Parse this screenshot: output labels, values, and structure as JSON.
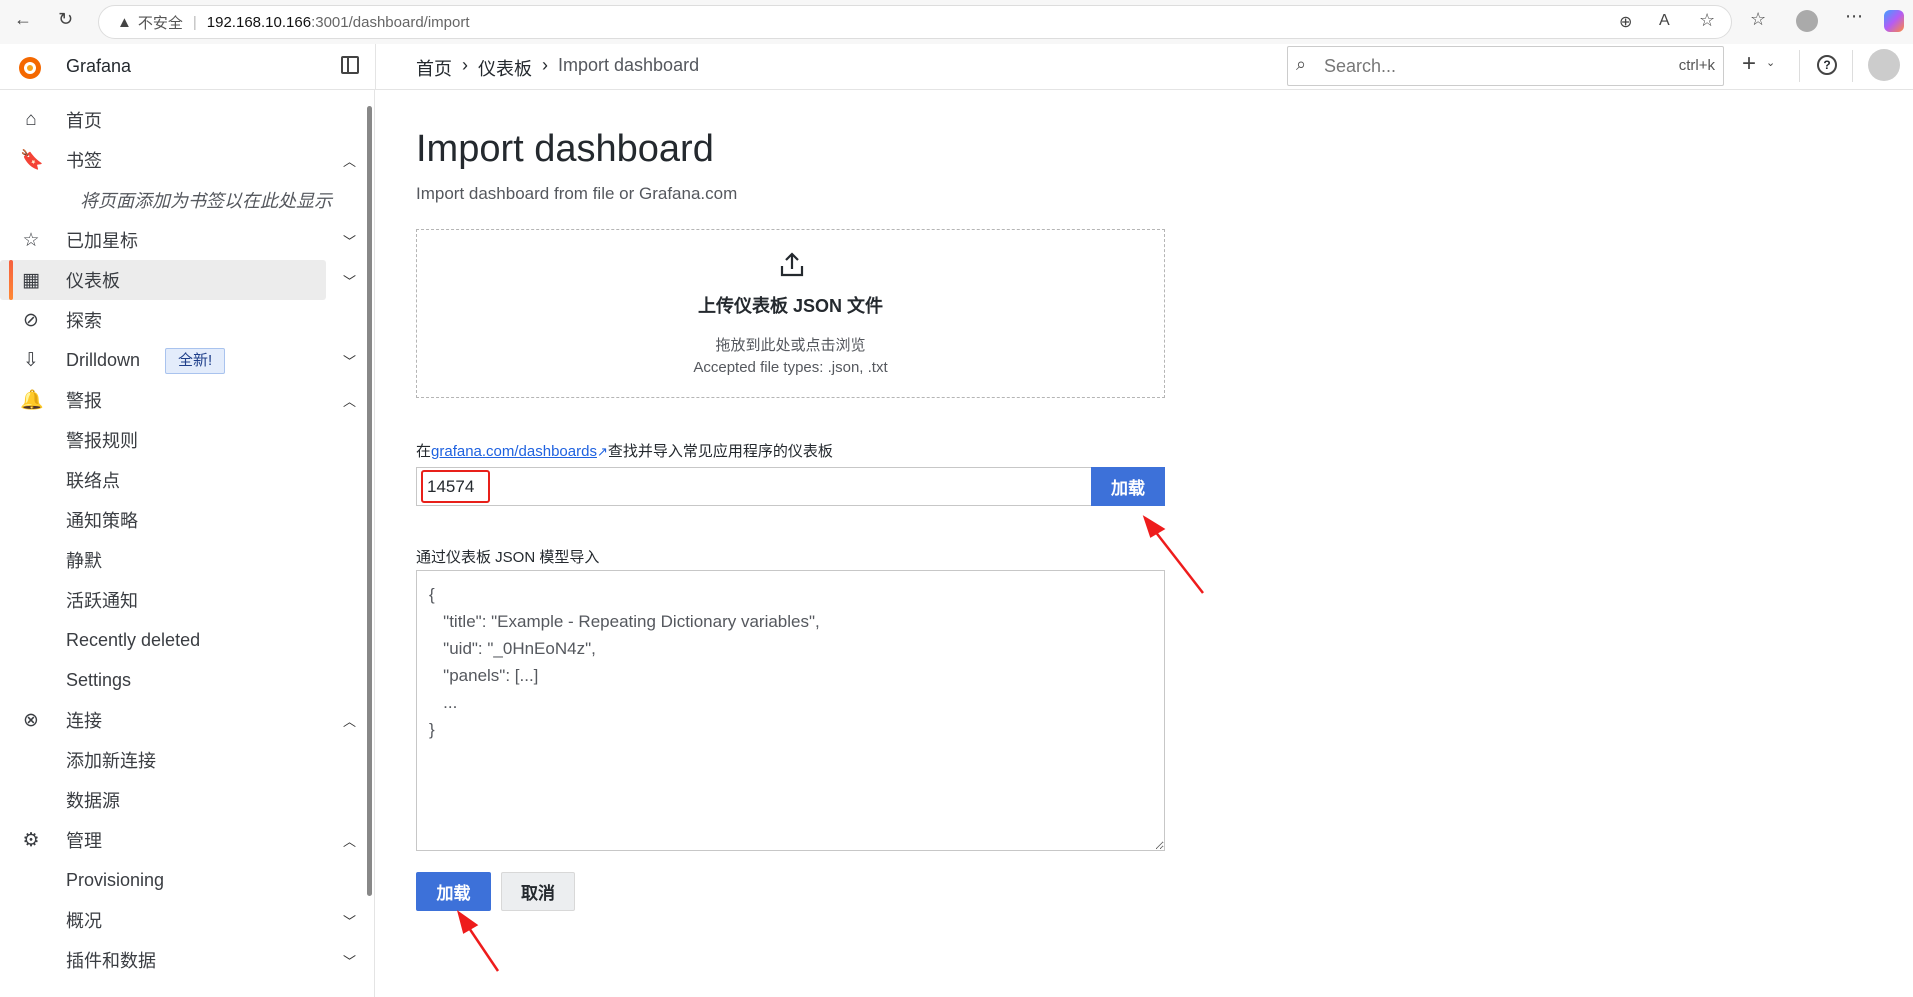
{
  "browser": {
    "security_label": "不安全",
    "url_host": "192.168.10.166",
    "url_path": ":3001/dashboard/import"
  },
  "header": {
    "app_name": "Grafana",
    "breadcrumb": [
      "首页",
      "仪表板",
      "Import dashboard"
    ],
    "search_placeholder": "Search...",
    "search_shortcut": "ctrl+k"
  },
  "sidebar": {
    "items": [
      {
        "label": "首页",
        "icon": "home-icon"
      },
      {
        "label": "书签",
        "icon": "bookmark-icon",
        "chevron": "up"
      },
      {
        "label": "将页面添加为书签以在此处显示",
        "hint": true
      },
      {
        "label": "已加星标",
        "icon": "star-icon",
        "chevron": "down"
      },
      {
        "label": "仪表板",
        "icon": "apps-icon",
        "chevron": "down",
        "active": true
      },
      {
        "label": "探索",
        "icon": "compass-icon"
      },
      {
        "label": "Drilldown",
        "icon": "drilldown-icon",
        "chevron": "down",
        "badge": "全新!"
      },
      {
        "label": "警报",
        "icon": "bell-icon",
        "chevron": "up"
      },
      {
        "label": "警报规则"
      },
      {
        "label": "联络点"
      },
      {
        "label": "通知策略"
      },
      {
        "label": "静默"
      },
      {
        "label": "活跃通知"
      },
      {
        "label": "Recently deleted"
      },
      {
        "label": "Settings"
      },
      {
        "label": "连接",
        "icon": "link-icon",
        "chevron": "up"
      },
      {
        "label": "添加新连接"
      },
      {
        "label": "数据源"
      },
      {
        "label": "管理",
        "icon": "gear-icon",
        "chevron": "up"
      },
      {
        "label": "Provisioning"
      },
      {
        "label": "概况",
        "chevron": "down"
      },
      {
        "label": "插件和数据",
        "chevron": "down"
      }
    ]
  },
  "main": {
    "title": "Import dashboard",
    "subtitle": "Import dashboard from file or Grafana.com",
    "upload": {
      "title": "上传仪表板 JSON 文件",
      "hint": "拖放到此处或点击浏览",
      "types": "Accepted file types: .json, .txt"
    },
    "gcom": {
      "prefix": "在",
      "link": "grafana.com/dashboards",
      "suffix": "查找并导入常见应用程序的仪表板",
      "value": "14574",
      "load": "加载"
    },
    "json": {
      "label": "通过仪表板 JSON 模型导入",
      "placeholder": "{\n   \"title\": \"Example - Repeating Dictionary variables\",\n   \"uid\": \"_0HnEoN4z\",\n   \"panels\": [...]\n   ...\n}"
    },
    "load_button": "加载",
    "cancel_button": "取消"
  }
}
